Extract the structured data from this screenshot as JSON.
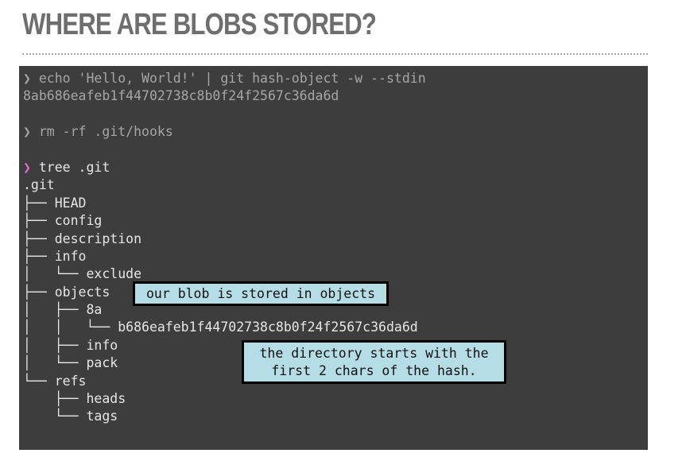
{
  "title": "WHERE ARE BLOBS STORED?",
  "terminal": {
    "prompt_symbol": "❯",
    "lines": [
      {
        "prompt": true,
        "active": false,
        "text": " echo 'Hello, World!' | git hash-object -w --stdin"
      },
      {
        "prompt": false,
        "text": "8ab686eafeb1f44702738c8b0f24f2567c36da6d",
        "dim": true
      },
      {
        "prompt": false,
        "text": "",
        "dim": true
      },
      {
        "prompt": true,
        "active": false,
        "text": " rm -rf .git/hooks"
      },
      {
        "prompt": false,
        "text": "",
        "dim": true
      },
      {
        "prompt": true,
        "active": true,
        "text": " tree .git"
      },
      {
        "prompt": false,
        "text": ".git"
      },
      {
        "prompt": false,
        "text": "├── HEAD"
      },
      {
        "prompt": false,
        "text": "├── config"
      },
      {
        "prompt": false,
        "text": "├── description"
      },
      {
        "prompt": false,
        "text": "├── info"
      },
      {
        "prompt": false,
        "text": "│   └── exclude"
      },
      {
        "prompt": false,
        "text": "├── objects"
      },
      {
        "prompt": false,
        "text": "│   ├── 8a"
      },
      {
        "prompt": false,
        "text": "│   │   └── b686eafeb1f44702738c8b0f24f2567c36da6d"
      },
      {
        "prompt": false,
        "text": "│   ├── info"
      },
      {
        "prompt": false,
        "text": "│   └── pack"
      },
      {
        "prompt": false,
        "text": "└── refs"
      },
      {
        "prompt": false,
        "text": "    ├── heads"
      },
      {
        "prompt": false,
        "text": "    └── tags"
      }
    ]
  },
  "callouts": {
    "objects_note": "our blob is stored in objects",
    "directory_note": "the directory starts with the\nfirst 2 chars of the hash."
  },
  "colors": {
    "background": "#ffffff",
    "title": "#6e6e6e",
    "terminal_bg": "#3d3d3d",
    "terminal_text": "#e6e6e6",
    "prompt_active": "#d86fd0",
    "callout_bg": "#b4dde6"
  }
}
